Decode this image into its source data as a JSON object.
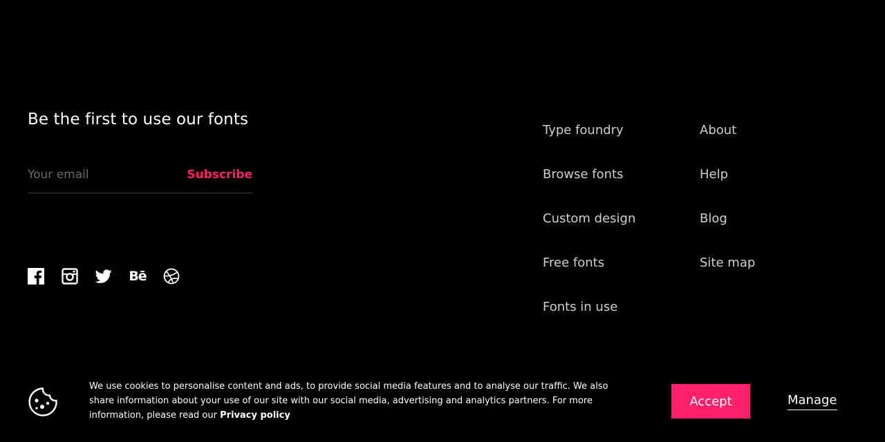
{
  "newsletter": {
    "title": "Be the first to use our fonts",
    "email_placeholder": "Your email",
    "subscribe_label": "Subscribe"
  },
  "socials": {
    "behance_label": "Bē",
    "items": [
      "facebook-icon",
      "instagram-icon",
      "twitter-icon",
      "behance-icon",
      "dribbble-icon"
    ]
  },
  "nav": {
    "column1": [
      "Type foundry",
      "Browse fonts",
      "Custom design",
      "Free fonts",
      "Fonts in use"
    ],
    "column2": [
      "About",
      "Help",
      "Blog",
      "Site map"
    ]
  },
  "cookie": {
    "icon": "cookie-icon",
    "text": "We use cookies to personalise content and ads, to provide social media features and to analyse our traffic. We also share information about your use of our site with our social media, advertising and analytics partners. For more information, please read our",
    "privacy_link": "Privacy policy",
    "accept_label": "Accept",
    "manage_label": "Manage"
  },
  "colors": {
    "background": "#000000",
    "accent": "#ff1f6b",
    "text": "#ffffff",
    "nav_text": "#cfcfcf",
    "placeholder": "#6b6b6b"
  }
}
